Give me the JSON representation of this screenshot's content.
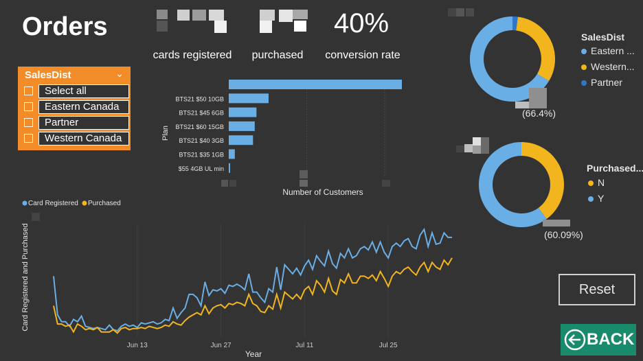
{
  "page_title": "Orders",
  "kpis": [
    {
      "value": "",
      "label": "cards registered"
    },
    {
      "value": "",
      "label": "purchased"
    },
    {
      "value": "40%",
      "label": "conversion rate"
    }
  ],
  "slicer": {
    "title": "SalesDist",
    "items": [
      "Select all",
      "Eastern Canada",
      "Partner",
      "Western Canada"
    ]
  },
  "colors": {
    "blue": "#6aaee6",
    "yellow": "#f2b51e",
    "darkblue": "#2f78c8",
    "orange": "#f28c28",
    "back_green": "#1a8a6c"
  },
  "donut1": {
    "legend_title": "SalesDist",
    "legend": [
      {
        "label": "Eastern ...",
        "color": "#6aaee6"
      },
      {
        "label": "Western...",
        "color": "#f2b51e"
      },
      {
        "label": "Partner",
        "color": "#2f78c8"
      }
    ],
    "data_label": "(66.4%)"
  },
  "donut2": {
    "legend_title": "Purchased...",
    "legend": [
      {
        "label": "N",
        "color": "#f2b51e"
      },
      {
        "label": "Y",
        "color": "#6aaee6"
      }
    ],
    "data_label": "(60.09%)"
  },
  "buttons": {
    "reset": "Reset",
    "back": "BACK"
  },
  "chart_data": [
    {
      "type": "bar",
      "orientation": "horizontal",
      "categories": [
        "",
        "BTS21 $50 10GB",
        "BTS21 $45 6GB",
        "BTS21 $60 15GB",
        "BTS21 $40 3GB",
        "BTS21 $35 1GB",
        "$55 4GB UL min"
      ],
      "values": [
        100,
        23,
        16,
        15,
        14,
        3.5,
        0.8
      ],
      "xlabel": "Number of Customers",
      "ylabel": "Plan",
      "xlim": [
        0,
        100
      ]
    },
    {
      "type": "pie",
      "donut": true,
      "labels": [
        "Eastern Canada",
        "Western Canada",
        "Partner"
      ],
      "values": [
        66.4,
        31.6,
        2.0
      ]
    },
    {
      "type": "pie",
      "donut": true,
      "labels": [
        "N",
        "Y"
      ],
      "values": [
        39.91,
        60.09
      ]
    },
    {
      "type": "line",
      "title": "",
      "xlabel": "Year",
      "ylabel": "Card Registered and Purchased",
      "x_ticks": [
        "Jun 13",
        "Jun 27",
        "Jul 11",
        "Jul 25"
      ],
      "ylim": [
        0,
        100
      ],
      "series": [
        {
          "name": "Card Registered",
          "color": "#6aaee6",
          "values": [
            54,
            20,
            14,
            14,
            10,
            16,
            14,
            19,
            10,
            9,
            8,
            9,
            8,
            7,
            11,
            7,
            6,
            10,
            12,
            10,
            11,
            9,
            13,
            12,
            13,
            14,
            12,
            13,
            16,
            15,
            26,
            17,
            22,
            26,
            38,
            38,
            35,
            28,
            49,
            37,
            42,
            41,
            43,
            39,
            46,
            45,
            47,
            45,
            42,
            56,
            40,
            40,
            35,
            31,
            43,
            40,
            62,
            42,
            64,
            60,
            56,
            61,
            55,
            63,
            68,
            60,
            72,
            67,
            63,
            76,
            65,
            61,
            74,
            70,
            78,
            70,
            72,
            78,
            80,
            77,
            84,
            75,
            84,
            75,
            70,
            80,
            83,
            80,
            85,
            87,
            80,
            78,
            90,
            95,
            80,
            92,
            82,
            83,
            92,
            88,
            88
          ]
        },
        {
          "name": "Purchased",
          "color": "#f2b51e",
          "values": [
            28,
            12,
            12,
            10,
            11,
            5,
            12,
            10,
            7,
            8,
            7,
            9,
            5,
            5,
            5,
            7,
            4,
            8,
            9,
            7,
            8,
            8,
            9,
            8,
            10,
            9,
            8,
            9,
            11,
            10,
            14,
            12,
            11,
            15,
            18,
            20,
            22,
            20,
            28,
            21,
            26,
            28,
            29,
            26,
            30,
            29,
            31,
            30,
            28,
            38,
            30,
            28,
            23,
            22,
            28,
            25,
            38,
            26,
            40,
            37,
            34,
            38,
            34,
            42,
            45,
            38,
            50,
            46,
            40,
            52,
            41,
            38,
            51,
            48,
            56,
            48,
            48,
            54,
            54,
            52,
            55,
            50,
            58,
            52,
            45,
            54,
            58,
            56,
            60,
            62,
            58,
            55,
            62,
            66,
            58,
            66,
            62,
            60,
            68,
            64,
            70
          ]
        }
      ]
    }
  ]
}
